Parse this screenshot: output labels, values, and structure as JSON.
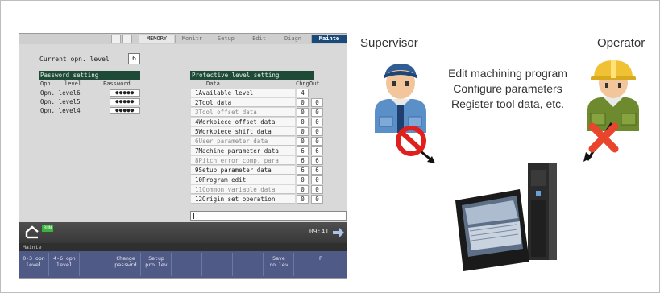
{
  "cnc": {
    "tabs": [
      "MEMORY",
      "Monitr",
      "Setup",
      "Edit",
      "Diagn",
      "Mainte"
    ],
    "current_level_label": "Current opn. level",
    "current_level_value": "6",
    "password": {
      "title": "Password setting",
      "headers": [
        "Opn.",
        "level",
        "Password"
      ],
      "rows": [
        {
          "label": "Opn. level6",
          "value": "●●●●●"
        },
        {
          "label": "Opn. level5",
          "value": "●●●●●"
        },
        {
          "label": "Opn. level4",
          "value": "●●●●●"
        }
      ]
    },
    "protect": {
      "title": "Protective level setting",
      "headers": [
        "Data",
        "ChngOut."
      ],
      "rows": [
        {
          "item": "1Available level",
          "v1": "4",
          "v2": ""
        },
        {
          "item": "2Tool data",
          "v1": "0",
          "v2": "0"
        },
        {
          "item": "3Tool offset data",
          "v1": "0",
          "v2": "0"
        },
        {
          "item": "4Workpiece offset data",
          "v1": "0",
          "v2": "0"
        },
        {
          "item": "5Workpiece shift data",
          "v1": "0",
          "v2": "0"
        },
        {
          "item": "6User parameter data",
          "v1": "0",
          "v2": "0"
        },
        {
          "item": "7Machine parameter data",
          "v1": "6",
          "v2": "6"
        },
        {
          "item": "8Pitch error comp. para",
          "v1": "6",
          "v2": "6"
        },
        {
          "item": "9Setup parameter data",
          "v1": "6",
          "v2": "6"
        },
        {
          "item": "10Program edit",
          "v1": "0",
          "v2": "0"
        },
        {
          "item": "11Common variable data",
          "v1": "0",
          "v2": "0"
        },
        {
          "item": "12Origin set operation",
          "v1": "0",
          "v2": "0"
        }
      ]
    },
    "status": {
      "run_badge": "RUN",
      "clock": "09:41"
    },
    "menu_label": "Mainte",
    "softkeys": [
      {
        "line1": "0-3 opn",
        "line2": "level"
      },
      {
        "line1": "4-6 opn",
        "line2": "level"
      },
      {
        "line1": "",
        "line2": ""
      },
      {
        "line1": "Change",
        "line2": "passwrd"
      },
      {
        "line1": "Setup",
        "line2": "pro lev"
      },
      {
        "line1": "",
        "line2": ""
      },
      {
        "line1": "",
        "line2": ""
      },
      {
        "line1": "",
        "line2": ""
      },
      {
        "line1": "Save",
        "line2": "ro lev"
      },
      {
        "line1": "P",
        "line2": ""
      }
    ]
  },
  "illustration": {
    "supervisor_label": "Supervisor",
    "operator_label": "Operator",
    "description": "Edit machining program Configure parameters Register tool data, etc."
  },
  "colors": {
    "screen_bg": "#d9d9d9",
    "section_title_bg": "#1f4a38",
    "active_tab_bg": "#1a4a7a",
    "softkey_bg": "#505a86",
    "prohibit_red": "#e0201c",
    "forbid_cross": "#e8452c"
  },
  "icons": [
    "home-icon",
    "next-arrow-icon",
    "prohibition-icon",
    "cross-icon",
    "hardhat-icon"
  ]
}
